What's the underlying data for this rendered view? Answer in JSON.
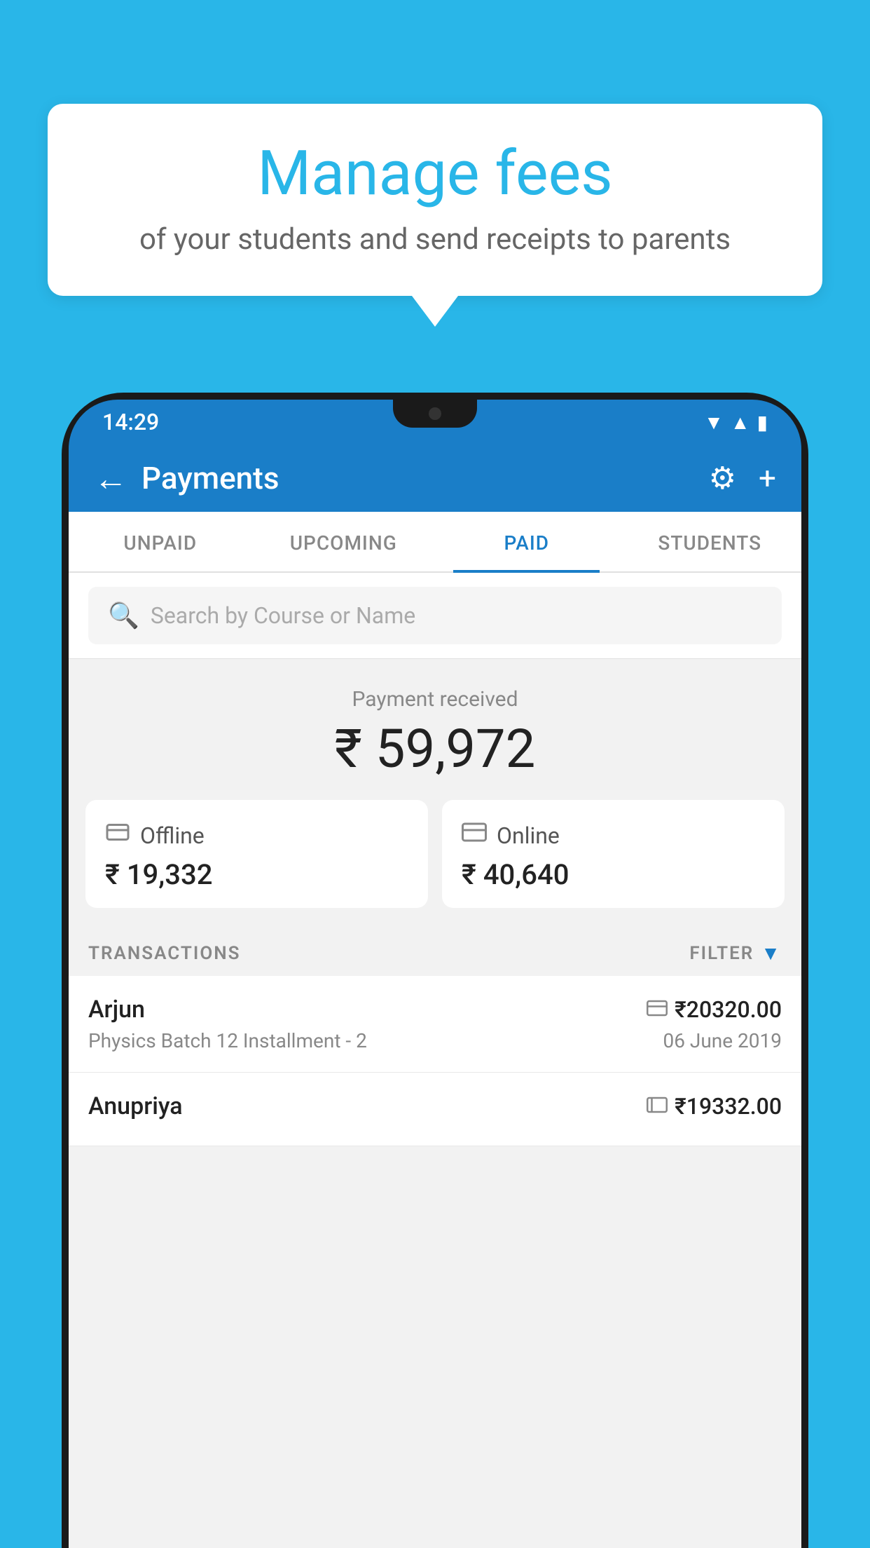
{
  "background_color": "#29b6e8",
  "bubble": {
    "title": "Manage fees",
    "subtitle": "of your students and send receipts to parents"
  },
  "status_bar": {
    "time": "14:29",
    "icons": [
      "wifi",
      "signal",
      "battery"
    ]
  },
  "header": {
    "title": "Payments",
    "back_label": "←",
    "settings_label": "⚙",
    "add_label": "+"
  },
  "tabs": [
    {
      "label": "UNPAID",
      "active": false
    },
    {
      "label": "UPCOMING",
      "active": false
    },
    {
      "label": "PAID",
      "active": true
    },
    {
      "label": "STUDENTS",
      "active": false
    }
  ],
  "search": {
    "placeholder": "Search by Course or Name"
  },
  "payment_received": {
    "label": "Payment received",
    "amount": "₹ 59,972"
  },
  "cards": [
    {
      "icon": "₹",
      "type": "Offline",
      "amount": "₹ 19,332"
    },
    {
      "icon": "▬",
      "type": "Online",
      "amount": "₹ 40,640"
    }
  ],
  "transactions_header": {
    "label": "TRANSACTIONS",
    "filter_label": "FILTER"
  },
  "transactions": [
    {
      "name": "Arjun",
      "type_icon": "card",
      "amount": "₹20320.00",
      "course": "Physics Batch 12 Installment - 2",
      "date": "06 June 2019"
    },
    {
      "name": "Anupriya",
      "type_icon": "cash",
      "amount": "₹19332.00",
      "course": "",
      "date": ""
    }
  ]
}
